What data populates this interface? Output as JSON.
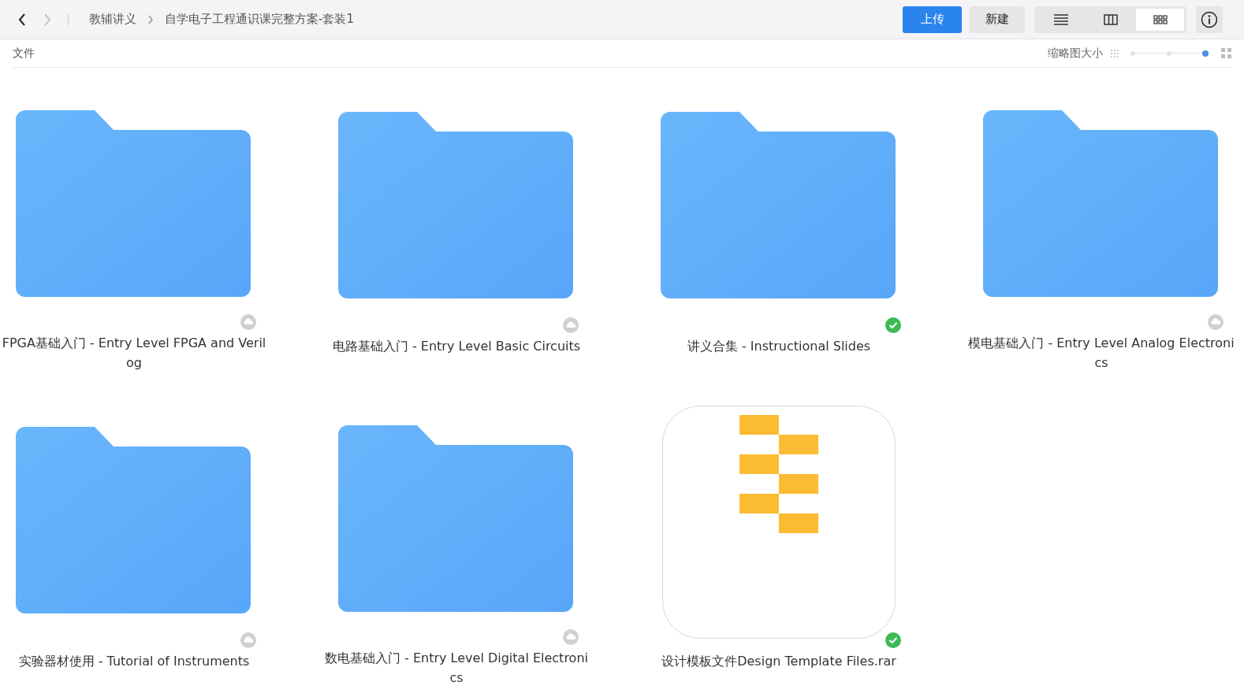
{
  "breadcrumb": [
    "教辅讲义",
    "自学电子工程通识课完整方案-套装1"
  ],
  "nav": {
    "back_disabled": false,
    "forward_disabled": true
  },
  "buttons": {
    "upload": "上传",
    "new": "新建"
  },
  "view_modes": [
    {
      "kind": "list",
      "selected": false
    },
    {
      "kind": "columns",
      "selected": false
    },
    {
      "kind": "grid",
      "selected": true
    }
  ],
  "section": "文件",
  "thumbnail_size": {
    "label": "缩略图大小",
    "level": 1.0
  },
  "items": [
    {
      "name": "FPGA基础入门 - Entry Level FPGA and Verilog",
      "kind": "folder",
      "synced": false
    },
    {
      "name": "电路基础入门 - Entry Level Basic Circuits",
      "kind": "folder",
      "synced": false
    },
    {
      "name": "讲义合集 - Instructional Slides",
      "kind": "folder",
      "synced": true
    },
    {
      "name": "模电基础入门 - Entry Level Analog Electronics",
      "kind": "folder",
      "synced": false
    },
    {
      "name": "实验器材使用 - Tutorial of Instruments",
      "kind": "folder",
      "synced": false
    },
    {
      "name": "数电基础入门 - Entry Level Digital Electronics",
      "kind": "folder",
      "synced": false
    },
    {
      "name": "设计模板文件Design Template Files.rar",
      "kind": "archive",
      "synced": true
    }
  ]
}
